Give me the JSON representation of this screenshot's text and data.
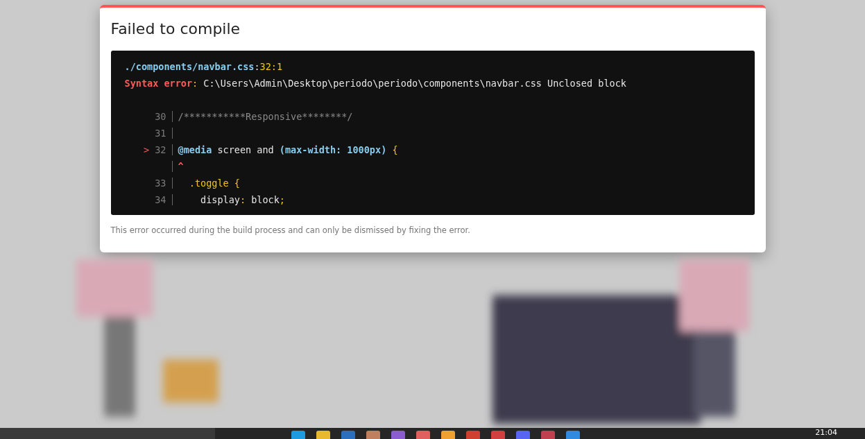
{
  "dialog": {
    "title": "Failed to compile",
    "code": {
      "header": [
        [
          {
            "text": "./components/navbar.css",
            "kind": "path"
          },
          {
            "text": ":",
            "kind": "plain"
          },
          {
            "text": "32:1",
            "kind": "punct"
          }
        ],
        [
          {
            "text": "Syntax error",
            "kind": "error"
          },
          {
            "text": ":",
            "kind": "punct"
          },
          {
            "text": " C:\\Users\\Admin\\Desktop\\periodo\\periodo\\components\\navbar.css Unclosed block",
            "kind": "plain"
          }
        ]
      ],
      "lines": [
        {
          "number": "30",
          "tokens": [
            {
              "text": "/***********Responsive********/",
              "kind": "comment"
            }
          ]
        },
        {
          "number": "31"
        },
        {
          "number": "32",
          "marker": ">",
          "tokens": [
            {
              "text": "@media",
              "kind": "path"
            },
            {
              "text": " screen and ",
              "kind": "plain"
            },
            {
              "text": "(max-width: 1000px)",
              "kind": "path"
            },
            {
              "text": " {",
              "kind": "punct"
            }
          ]
        },
        {
          "tokens": [
            {
              "text": "^",
              "kind": "error"
            }
          ]
        },
        {
          "number": "33",
          "tokens": [
            {
              "text": "  .toggle {",
              "kind": "punct"
            }
          ]
        },
        {
          "number": "34",
          "tokens": [
            {
              "text": "    display",
              "kind": "plain"
            },
            {
              "text": ":",
              "kind": "punct"
            },
            {
              "text": " block",
              "kind": "plain"
            },
            {
              "text": ";",
              "kind": "punct"
            }
          ]
        }
      ]
    },
    "note": "This error occurred during the build process and can only be dismissed by fixing the error."
  },
  "taskbar": {
    "clock": "21:04"
  }
}
